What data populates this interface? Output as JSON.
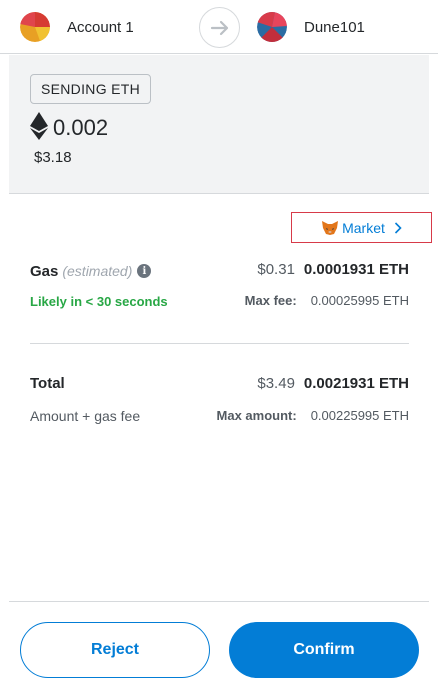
{
  "header": {
    "from_account": "Account 1",
    "to_account": "Dune101",
    "icons": {
      "from_avatar": "account-avatar-icon",
      "arrow": "arrow-right-icon",
      "to_avatar": "account-avatar-icon"
    }
  },
  "send": {
    "badge": "SENDING ETH",
    "amount": "0.002",
    "fiat": "$3.18",
    "currency_icon": "ethereum-icon"
  },
  "market": {
    "label": "Market",
    "icon": "fox-icon",
    "chevron": ">"
  },
  "gas": {
    "label": "Gas",
    "estimated_label": "(estimated)",
    "info_icon": "i",
    "fiat": "$0.31",
    "eth": "0.0001931 ETH",
    "likely": "Likely in < 30 seconds",
    "max_fee_label": "Max fee:",
    "max_fee_value": "0.00025995 ETH"
  },
  "total": {
    "label": "Total",
    "fiat": "$3.49",
    "eth": "0.0021931 ETH",
    "sub_label": "Amount + gas fee",
    "max_amount_label": "Max amount:",
    "max_amount_value": "0.00225995 ETH"
  },
  "actions": {
    "reject": "Reject",
    "confirm": "Confirm"
  },
  "colors": {
    "accent": "#037dd6",
    "success": "#28a745",
    "highlight_border": "#d73a49",
    "panel_bg": "#f2f3f4"
  }
}
